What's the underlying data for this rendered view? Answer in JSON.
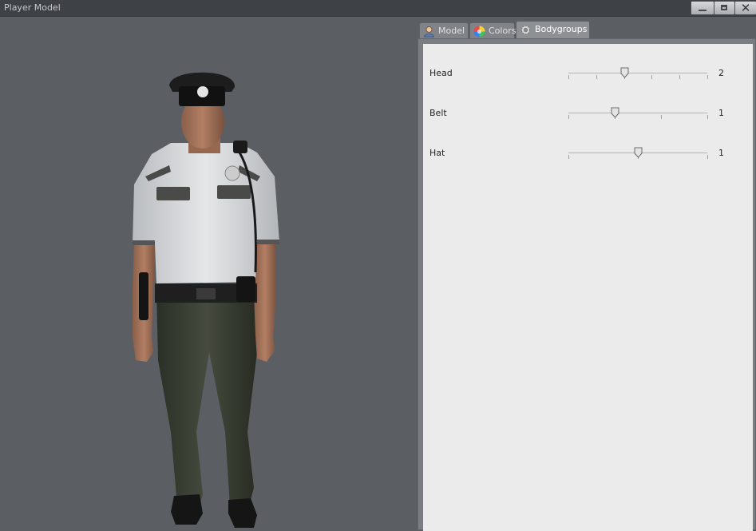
{
  "window": {
    "title": "Player Model"
  },
  "tabs": [
    {
      "label": "Model",
      "icon": "user-icon",
      "active": false
    },
    {
      "label": "Colors",
      "icon": "color-wheel-icon",
      "active": false
    },
    {
      "label": "Bodygroups",
      "icon": "gear-icon",
      "active": true
    }
  ],
  "bodygroups": [
    {
      "label": "Head",
      "value": "2",
      "max": 5
    },
    {
      "label": "Belt",
      "value": "1",
      "max": 3
    },
    {
      "label": "Hat",
      "value": "1",
      "max": 2
    }
  ],
  "viewport": {
    "model": "police-officer"
  },
  "colors": {
    "window_bg": "#5b5f64",
    "panel_bg": "#ebebeb",
    "titlebar": "#3e4247"
  }
}
